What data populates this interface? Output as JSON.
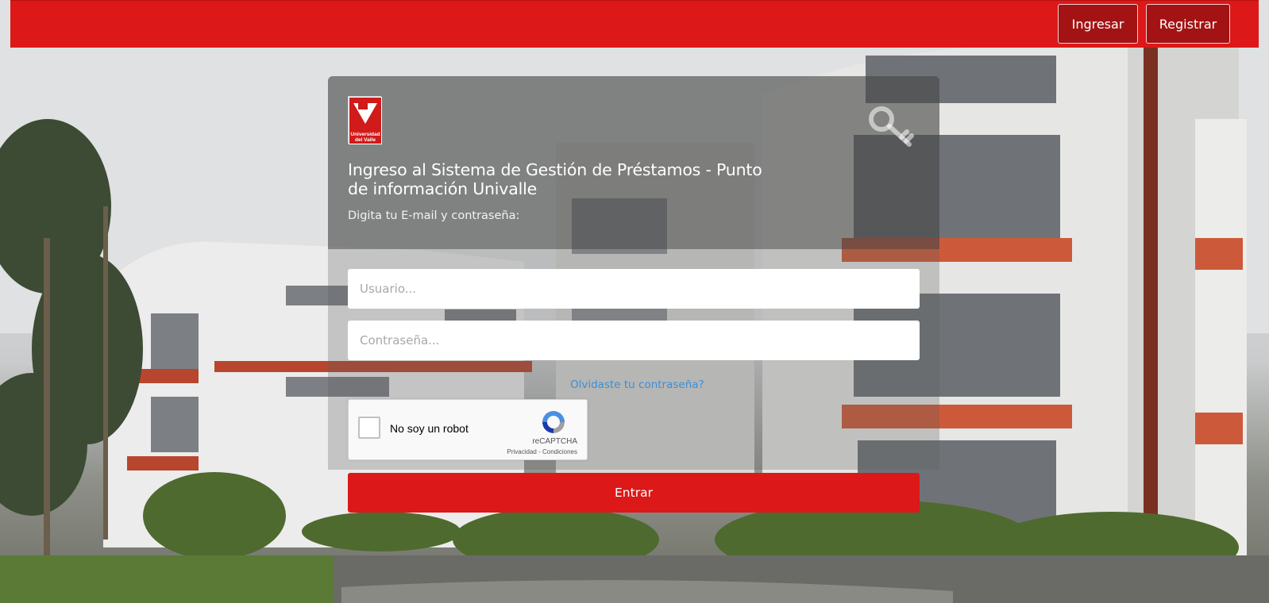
{
  "nav": {
    "login_label": "Ingresar",
    "register_label": "Registrar"
  },
  "logo": {
    "line1": "Universidad",
    "line2": "del Valle"
  },
  "login": {
    "title": "Ingreso al Sistema de Gestión de Préstamos - Punto de información Univalle",
    "subtitle": "Digita tu E-mail y contraseña:",
    "username_placeholder": "Usuario...",
    "password_placeholder": "Contraseña...",
    "forgot_link": "Olvidaste tu contraseña?",
    "submit_label": "Entrar"
  },
  "captcha": {
    "label": "No soy un robot",
    "brand": "reCAPTCHA",
    "links": "Privacidad - Condiciones"
  },
  "colors": {
    "brand_red": "#dc1818",
    "dark_red_button": "#a31313",
    "link_blue": "#3a8fd8"
  },
  "icons": {
    "header_icon": "key-icon",
    "captcha_icon": "recaptcha-logo-icon"
  }
}
